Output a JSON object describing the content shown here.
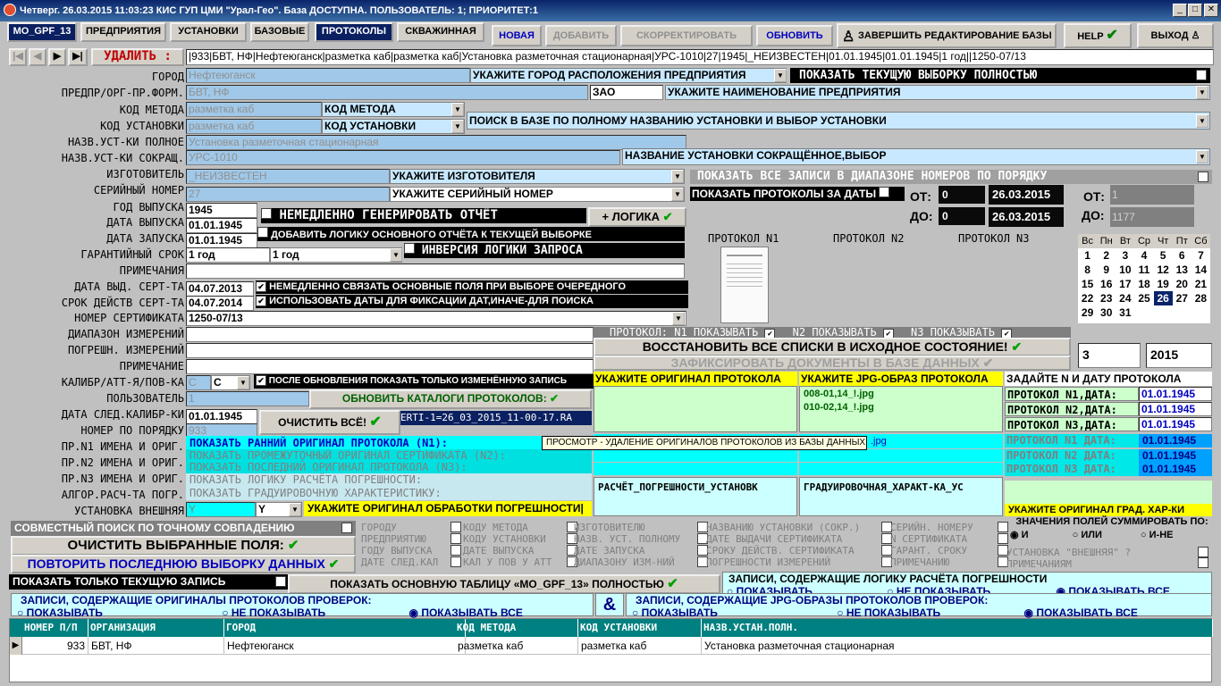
{
  "title": "Четверг. 26.03.2015 11:03:23 КИС ГУП ЦМИ \"Урал-Гео\". База ДОСТУПНА. ПОЛЬЗОВАТЕЛЬ: 1; ПРИОРИТЕТ:1",
  "tabs": [
    "MO_GPF_13",
    "ПРЕДПРИЯТИЯ",
    "УСТАНОВКИ",
    "БАЗОВЫЕ",
    "ПРОТОКОЛЫ",
    "СКВАЖИННАЯ"
  ],
  "toolbar": {
    "new": "НОВАЯ",
    "add": "ДОБАВИТЬ",
    "correct": "СКОРРЕКТИРОВАТЬ",
    "refresh": "ОБНОВИТЬ",
    "finish": "ЗАВЕРШИТЬ РЕДАКТИРОВАНИЕ БАЗЫ",
    "help": "HELP",
    "exit": "ВЫХОД"
  },
  "nav": {
    "delete": "УДАЛИТЬ :",
    "record": "|933|БВТ, НФ|Нефтеюганск|разметка каб|разметка каб|Установка разметочная стационарная|УРС-1010|27|1945|_НЕИЗВЕСТЕН|01.01.1945|01.01.1945|1 год||1250-07/13"
  },
  "labels": [
    "ГОРОД",
    "ПРЕДПР/ОРГ-ПР.ФОРМ.",
    "КОД МЕТОДА",
    "КОД УСТАНОВКИ",
    "НАЗВ.УСТ-КИ ПОЛНОЕ",
    "НАЗВ.УСТ-КИ СОКРАЩ.",
    "ИЗГОТОВИТЕЛЬ",
    "СЕРИЙНЫЙ НОМЕР",
    "ГОД ВЫПУСКА",
    "ДАТА ВЫПУСКА",
    "ДАТА ЗАПУСКА",
    "ГАРАНТИЙНЫЙ СРОК",
    "ПРИМЕЧАНИЯ",
    "ДАТА ВЫД. СЕРТ-ТА",
    "СРОК ДЕЙСТВ СЕРТ-ТА",
    "НОМЕР СЕРТИФИКАТА",
    "ДИАПАЗОН ИЗМЕРЕНИЙ",
    "ПОГРЕШН. ИЗМЕРЕНИЙ",
    "ПРИМЕЧАНИЕ",
    "КАЛИБР/АТТ-Я/ПОВ-КА",
    "ПОЛЬЗОВАТЕЛЬ",
    "ДАТА СЛЕД.КАЛИБР-КИ",
    "НОМЕР ПО ПОРЯДКУ",
    "ПР.N1 ИМЕНА И ОРИГ.",
    "ПР.N2 ИМЕНА И ОРИГ.",
    "ПР.N3 ИМЕНА И ОРИГ.",
    "АЛГОР.РАСЧ-ТА ПОГР.",
    "УСТАНОВКА ВНЕШНЯЯ"
  ],
  "fields": {
    "city": "Нефтеюганск",
    "org": "БВТ, НФ",
    "form": "ЗАО",
    "method": "разметка каб",
    "method_sel": "КОД МЕТОДА",
    "unit": "разметка каб",
    "unit_sel": "КОД УСТАНОВКИ",
    "full_name": "Установка разметочная стационарная",
    "short_name": "УРС-1010",
    "maker": "_НЕИЗВЕСТЕН",
    "serial": "27",
    "year": "1945",
    "date_out": "01.01.1945",
    "date_start": "01.01.1945",
    "warranty": "1 год",
    "warranty_sel": "1 год",
    "cert_date": "04.07.2013",
    "cert_valid": "04.07.2014",
    "cert_no": "1250-07/13",
    "calib": "С",
    "calib_sel": "С",
    "user": "1",
    "next_calib": "01.01.1945",
    "order_no": "933",
    "external": "Y",
    "external_sel": "Y"
  },
  "hints": {
    "city": "УКАЖИТЕ ГОРОД РАСПОЛОЖЕНИЯ ПРЕДПРИЯТИЯ",
    "org": "УКАЖИТЕ НАИМЕНОВАНИЕ ПРЕДПРИЯТИЯ",
    "search_unit": "ПОИСК В БАЗЕ ПО ПОЛНОМУ НАЗВАНИЮ УСТАНОВКИ И ВЫБОР УСТАНОВКИ",
    "short": "НАЗВАНИЕ УСТАНОВКИ СОКРАЩЁННОЕ,ВЫБОР",
    "maker": "УКАЖИТЕ ИЗГОТОВИТЕЛЯ",
    "serial": "УКАЖИТЕ СЕРИЙНЫЙ НОМЕР"
  },
  "right": {
    "show_all": "ПОКАЗАТЬ ТЕКУЩУЮ ВЫБОРКУ ПОЛНОСТЬЮ",
    "show_range": "ПОКАЗАТЬ ВСЕ ЗАПИСИ В ДИАПАЗОНЕ НОМЕРОВ ПО ПОРЯДКУ",
    "show_dates": "ПОКАЗАТЬ ПРОТОКОЛЫ ЗА ДАТЫ",
    "from": "ОТ:",
    "to": "ДО:",
    "from_n": "0",
    "to_n": "0",
    "from_date": "26.03.2015",
    "to_date": "26.03.2015",
    "r_from": "1",
    "r_to": "1177",
    "p1": "ПРОТОКОЛ N1",
    "p2": "ПРОТОКОЛ N2",
    "p3": "ПРОТОКОЛ N3",
    "show1": "ПРОТОКОЛ: N1 ПОКАЗЫВАТЬ",
    "show2": "N2 ПОКАЗЫВАТЬ",
    "show3": "N3 ПОКАЗЫВАТЬ",
    "restore": "ВОССТАНОВИТЬ ВСЕ СПИСКИ В ИСХОДНОЕ СОСТОЯНИЕ!",
    "fix": "ЗАФИКСИРОВАТЬ ДОКУМЕНТЫ В БАЗЕ ДАННЫХ",
    "month": "3",
    "yr": "2015"
  },
  "calendar": {
    "head": [
      "Вс",
      "Пн",
      "Вт",
      "Ср",
      "Чт",
      "Пт",
      "Сб"
    ],
    "rows": [
      [
        "1",
        "2",
        "3",
        "4",
        "5",
        "6",
        "7"
      ],
      [
        "8",
        "9",
        "10",
        "11",
        "12",
        "13",
        "14"
      ],
      [
        "15",
        "16",
        "17",
        "18",
        "19",
        "20",
        "21"
      ],
      [
        "22",
        "23",
        "24",
        "25",
        "26",
        "27",
        "28"
      ],
      [
        "29",
        "30",
        "31",
        "",
        "",
        "",
        ""
      ]
    ]
  },
  "mid": {
    "gen": "НЕМЕДЛЕННО ГЕНЕРИРОВАТЬ ОТЧЁТ",
    "logic": "+ ЛОГИКА",
    "add_logic": "ДОБАВИТЬ ЛОГИКУ ОСНОВНОГО ОТЧЁТА К ТЕКУЩЕЙ ВЫБОРКЕ",
    "inv": "ИНВЕРСИЯ ЛОГИКИ ЗАПРОСА",
    "link": "НЕМЕДЛЕННО СВЯЗАТЬ ОСНОВНЫЕ ПОЛЯ ПРИ ВЫБОРЕ ОЧЕРЕДНОГО",
    "use_dates": "ИСПОЛЬЗОВАТЬ ДАТЫ ДЛЯ ФИКСАЦИИ ДАТ,ИНАЧЕ-ДЛЯ ПОИСКА",
    "after_upd": "ПОСЛЕ ОБНОВЛЕНИЯ ПОКАЗАТЬ ТОЛЬКО ИЗМЕНЁННУЮ ЗАПИСЬ",
    "upd_cat": "ОБНОВИТЬ КАТАЛОГИ ПРОТОКОЛОВ:",
    "clear": "ОЧИСТИТЬ ВСЁ!",
    "ert": "ERTI-1=26_03_2015_11-00-17.RA",
    "show_early": "ПОКАЗАТЬ РАННИЙ ОРИГИНАЛ ПРОТОКОЛА (N1):",
    "show_mid": "ПОКАЗАТЬ ПРОМЕЖУТОЧНЫЙ ОРИГИНАЛ СЕРТИФИКАТА (N2):",
    "show_last": "ПОКАЗАТЬ ПОСЛЕДНИЙ ОРИГИНАЛ ПРОТОКОЛА (N3):",
    "show_logic": "ПОКАЗАТЬ ЛОГИКУ РАСЧЁТА ПОГРЕШНОСТИ:",
    "show_grad": "ПОКАЗАТЬ ГРАДУИРОВОЧНУЮ ХАРАКТЕРИСТИКУ:",
    "orig_proc": "УКАЖИТЕ ОРИГИНАЛ ОБРАБОТКИ ПОГРЕШНОСТИ|",
    "tooltip": "ПРОСМОТР - УДАЛЕНИЕ ОРИГИНАЛОВ ПРОТОКОЛОВ ИЗ БАЗЫ ДАННЫХ"
  },
  "protocols": {
    "orig": "УКАЖИТЕ ОРИГИНАЛ ПРОТОКОЛА",
    "jpg": "УКАЖИТЕ JPG-ОБРАЗ ПРОТОКОЛА",
    "date_hdr": "ЗАДАЙТЕ N И ДАТУ ПРОТОКОЛА",
    "jpg_files": [
      "008-01,14_!.jpg",
      "010-02,14_!.jpg"
    ],
    "jpg_cut": ".jpg",
    "calc": "РАСЧЁТ_ПОГРЕШНОСТИ_УСТАНОВК",
    "grad": "ГРАДУИРОВОЧНАЯ_ХАРАКТ-КА_УС",
    "p_rows": [
      "ПРОТОКОЛ N1,ДАТА:",
      "ПРОТОКОЛ N2,ДАТА:",
      "ПРОТОКОЛ N3,ДАТА:"
    ],
    "p_dates": [
      "01.01.1945",
      "01.01.1945",
      "01.01.1945"
    ],
    "q_rows": [
      "ПРОТОКОЛ N1 ДАТА:",
      "ПРОТОКОЛ N2 ДАТА:",
      "ПРОТОКОЛ N3 ДАТА:"
    ],
    "q_dates": [
      "01.01.1945",
      "01.01.1945",
      "01.01.1945"
    ],
    "grad_orig": "УКАЖИТЕ ОРИГИНАЛ ГРАД. ХАР-КИ"
  },
  "bottom": {
    "joint": "СОВМЕСТНЫЙ ПОИСК ПО ТОЧНОМУ СОВПАДЕНИЮ",
    "clear_sel": "ОЧИСТИТЬ ВЫБРАННЫЕ ПОЛЯ:",
    "repeat": "ПОВТОРИТЬ ПОСЛЕДНЮЮ ВЫБОРКУ ДАННЫХ",
    "only_cur": "ПОКАЗАТЬ ТОЛЬКО ТЕКУЩУЮ ЗАПИСЬ",
    "main_tbl": "ПОКАЗАТЬ ОСНОВНУЮ ТАБЛИЦУ «MO_GPF_13» ПОЛНОСТЬЮ",
    "g1": [
      "ГОРОДУ",
      "ПРЕДПРИЯТИЮ",
      "ГОДУ ВЫПУСКА",
      "ДАТЕ СЛЕД.КАЛ"
    ],
    "g2": [
      "КОДУ МЕТОДА",
      "КОДУ УСТАНОВКИ",
      "ДАТЕ ВЫПУСКА",
      "КАЛ У ПОВ У АТТ"
    ],
    "g3": [
      "ИЗГОТОВИТЕЛЮ",
      "НАЗВ. УСТ. ПОЛНОМУ",
      "ДАТЕ ЗАПУСКА",
      "ДИАПАЗОНУ ИЗМ-НИЙ"
    ],
    "g4": [
      "НАЗВАНИЮ УСТАНОВКИ (СОКР.)",
      "ДАТЕ ВЫДАЧИ СЕРТИФИКАТА",
      "СРОКУ ДЕЙСТВ. СЕРТИФИКАТА",
      "ПОГРЕШНОСТИ ИЗМЕРЕНИЙ"
    ],
    "g5": [
      "СЕРИЙН. НОМЕРУ",
      "N СЕРТИФИКАТА",
      "ГАРАНТ. СРОКУ",
      "ПРИМЕЧАНИЮ"
    ],
    "sum": "ЗНАЧЕНИЯ ПОЛЕЙ СУММИРОВАТЬ ПО:",
    "sum_opts": [
      "И",
      "ИЛИ",
      "И-НЕ"
    ],
    "ext": "УСТАНОВКА \"ВНЕШНЯЯ\" ?",
    "note": "ПРИМЕЧАНИЯМ",
    "logic_hdr": "ЗАПИСИ, СОДЕРЖАЩИЕ ЛОГИКУ РАСЧЁТА ПОГРЕШНОСТИ",
    "orig_hdr": "ЗАПИСИ, СОДЕРЖАЩИЕ ОРИГИНАЛЫ ПРОТОКОЛОВ ПРОВЕРОК:",
    "jpg_hdr": "ЗАПИСИ, СОДЕРЖАЩИЕ JPG-ОБРАЗЫ ПРОТОКОЛОВ ПРОВЕРОК:",
    "opts": [
      "ПОКАЗЫВАТЬ",
      "НЕ ПОКАЗЫВАТЬ",
      "ПОКАЗЫВАТЬ ВСЕ"
    ],
    "amp": "&"
  },
  "grid": {
    "headers": [
      "НОМЕР П/П",
      "ОРГАНИЗАЦИЯ",
      "ГОРОД",
      "КОД МЕТОДА",
      "КОД УСТАНОВКИ",
      "НАЗВ.УСТАН.ПОЛН."
    ],
    "row": [
      "933",
      "БВТ, НФ",
      "Нефтеюганск",
      "разметка каб",
      "разметка каб",
      "Установка разметочная стационарная"
    ]
  }
}
